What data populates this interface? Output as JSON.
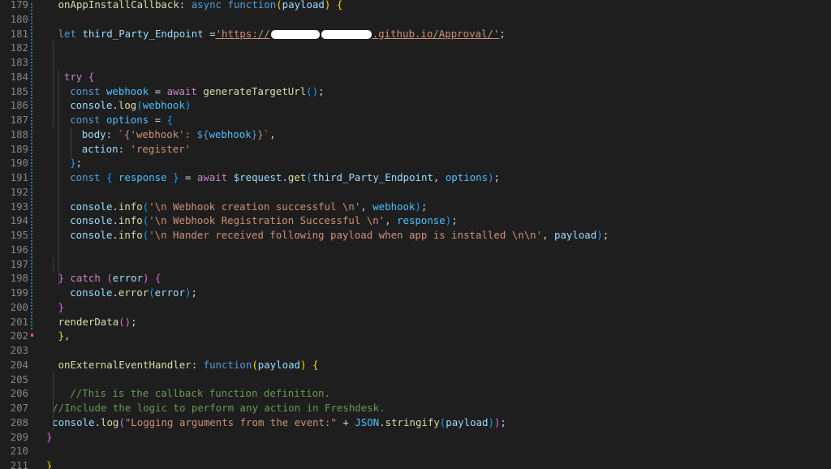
{
  "colors": {
    "background": "#1e1e1e",
    "line_number": "#858585",
    "default_text": "#d4d4d4",
    "change_marker": "#1b81a8",
    "deleted_marker": "#e85858"
  },
  "editor": {
    "lines": [
      {
        "n": "179",
        "indent": 2,
        "tokens": [
          {
            "t": "onAppInstallCallback",
            "c": "#dcdcaa",
            "name": "function-name"
          },
          {
            "t": ": ",
            "c": "#d4d4d4"
          },
          {
            "t": "async",
            "c": "#569cd6",
            "name": "keyword"
          },
          {
            "t": " ",
            "c": "#d4d4d4"
          },
          {
            "t": "function",
            "c": "#569cd6",
            "name": "keyword"
          },
          {
            "t": "(",
            "c": "#ffd700"
          },
          {
            "t": "payload",
            "c": "#9cdcfe",
            "name": "identifier"
          },
          {
            "t": ")",
            "c": "#ffd700"
          },
          {
            "t": " ",
            "c": "#d4d4d4"
          },
          {
            "t": "{",
            "c": "#ffd700"
          }
        ]
      },
      {
        "n": "180",
        "indent": 0,
        "tokens": []
      },
      {
        "n": "181",
        "indent": 2,
        "tokens": [
          {
            "t": "let",
            "c": "#569cd6",
            "name": "keyword"
          },
          {
            "t": " ",
            "c": "#d4d4d4"
          },
          {
            "t": "third_Party_Endpoint",
            "c": "#9cdcfe",
            "name": "identifier"
          },
          {
            "t": " =",
            "c": "#d4d4d4"
          },
          {
            "t": "'https://",
            "c": "#ce9178",
            "name": "string",
            "underline": true
          },
          {
            "redact": 60
          },
          {
            "t": "",
            "c": "#ce9178",
            "name": "string"
          },
          {
            "redact": 62
          },
          {
            "t": ".github.io/Approval/'",
            "c": "#ce9178",
            "name": "string",
            "underline": true
          },
          {
            "t": ";",
            "c": "#d4d4d4"
          }
        ]
      },
      {
        "n": "182",
        "indent": 0,
        "tokens": []
      },
      {
        "n": "183",
        "indent": 0,
        "tokens": []
      },
      {
        "n": "184",
        "indent": 3,
        "tokens": [
          {
            "t": "try",
            "c": "#c586c0",
            "name": "keyword"
          },
          {
            "t": " ",
            "c": "#d4d4d4"
          },
          {
            "t": "{",
            "c": "#da70d6"
          }
        ]
      },
      {
        "n": "185",
        "indent": 4,
        "tokens": [
          {
            "t": "const",
            "c": "#569cd6",
            "name": "keyword"
          },
          {
            "t": " ",
            "c": "#d4d4d4"
          },
          {
            "t": "webhook",
            "c": "#4fc1ff",
            "name": "identifier"
          },
          {
            "t": " = ",
            "c": "#d4d4d4"
          },
          {
            "t": "await",
            "c": "#c586c0",
            "name": "keyword"
          },
          {
            "t": " ",
            "c": "#d4d4d4"
          },
          {
            "t": "generateTargetUrl",
            "c": "#dcdcaa",
            "name": "function-name"
          },
          {
            "t": "()",
            "c": "#179fff"
          },
          {
            "t": ";",
            "c": "#d4d4d4"
          }
        ]
      },
      {
        "n": "186",
        "indent": 4,
        "tokens": [
          {
            "t": "console",
            "c": "#9cdcfe",
            "name": "identifier"
          },
          {
            "t": ".",
            "c": "#d4d4d4"
          },
          {
            "t": "log",
            "c": "#dcdcaa",
            "name": "function-name"
          },
          {
            "t": "(",
            "c": "#179fff"
          },
          {
            "t": "webhook",
            "c": "#4fc1ff",
            "name": "identifier"
          },
          {
            "t": ")",
            "c": "#179fff"
          }
        ]
      },
      {
        "n": "187",
        "indent": 4,
        "tokens": [
          {
            "t": "const",
            "c": "#569cd6",
            "name": "keyword"
          },
          {
            "t": " ",
            "c": "#d4d4d4"
          },
          {
            "t": "options",
            "c": "#4fc1ff",
            "name": "identifier"
          },
          {
            "t": " = ",
            "c": "#d4d4d4"
          },
          {
            "t": "{",
            "c": "#179fff"
          }
        ]
      },
      {
        "n": "188",
        "indent": 6,
        "tokens": [
          {
            "t": "body",
            "c": "#9cdcfe",
            "name": "identifier"
          },
          {
            "t": ": ",
            "c": "#d4d4d4"
          },
          {
            "t": "`{'webhook': ",
            "c": "#ce9178",
            "name": "string"
          },
          {
            "t": "${",
            "c": "#569cd6"
          },
          {
            "t": "webhook",
            "c": "#4fc1ff",
            "name": "identifier"
          },
          {
            "t": "}",
            "c": "#569cd6"
          },
          {
            "t": "}`",
            "c": "#ce9178",
            "name": "string"
          },
          {
            "t": ",",
            "c": "#d4d4d4"
          }
        ]
      },
      {
        "n": "189",
        "indent": 6,
        "tokens": [
          {
            "t": "action",
            "c": "#9cdcfe",
            "name": "identifier"
          },
          {
            "t": ": ",
            "c": "#d4d4d4"
          },
          {
            "t": "'register'",
            "c": "#ce9178",
            "name": "string"
          }
        ]
      },
      {
        "n": "190",
        "indent": 4,
        "tokens": [
          {
            "t": "}",
            "c": "#179fff"
          },
          {
            "t": ";",
            "c": "#d4d4d4"
          }
        ]
      },
      {
        "n": "191",
        "indent": 4,
        "tokens": [
          {
            "t": "const",
            "c": "#569cd6",
            "name": "keyword"
          },
          {
            "t": " ",
            "c": "#d4d4d4"
          },
          {
            "t": "{",
            "c": "#179fff"
          },
          {
            "t": " ",
            "c": "#d4d4d4"
          },
          {
            "t": "response",
            "c": "#4fc1ff",
            "name": "identifier"
          },
          {
            "t": " ",
            "c": "#d4d4d4"
          },
          {
            "t": "}",
            "c": "#179fff"
          },
          {
            "t": " = ",
            "c": "#d4d4d4"
          },
          {
            "t": "await",
            "c": "#c586c0",
            "name": "keyword"
          },
          {
            "t": " ",
            "c": "#d4d4d4"
          },
          {
            "t": "$request",
            "c": "#9cdcfe",
            "name": "identifier"
          },
          {
            "t": ".",
            "c": "#d4d4d4"
          },
          {
            "t": "get",
            "c": "#dcdcaa",
            "name": "function-name"
          },
          {
            "t": "(",
            "c": "#179fff"
          },
          {
            "t": "third_Party_Endpoint",
            "c": "#9cdcfe",
            "name": "identifier"
          },
          {
            "t": ", ",
            "c": "#d4d4d4"
          },
          {
            "t": "options",
            "c": "#4fc1ff",
            "name": "identifier"
          },
          {
            "t": ")",
            "c": "#179fff"
          },
          {
            "t": ";",
            "c": "#d4d4d4"
          }
        ]
      },
      {
        "n": "192",
        "indent": 0,
        "tokens": []
      },
      {
        "n": "193",
        "indent": 4,
        "tokens": [
          {
            "t": "console",
            "c": "#9cdcfe",
            "name": "identifier"
          },
          {
            "t": ".",
            "c": "#d4d4d4"
          },
          {
            "t": "info",
            "c": "#dcdcaa",
            "name": "function-name"
          },
          {
            "t": "(",
            "c": "#179fff"
          },
          {
            "t": "'\\n Webhook creation successful \\n'",
            "c": "#ce9178",
            "name": "string"
          },
          {
            "t": ", ",
            "c": "#d4d4d4"
          },
          {
            "t": "webhook",
            "c": "#4fc1ff",
            "name": "identifier"
          },
          {
            "t": ")",
            "c": "#179fff"
          },
          {
            "t": ";",
            "c": "#d4d4d4"
          }
        ]
      },
      {
        "n": "194",
        "indent": 4,
        "tokens": [
          {
            "t": "console",
            "c": "#9cdcfe",
            "name": "identifier"
          },
          {
            "t": ".",
            "c": "#d4d4d4"
          },
          {
            "t": "info",
            "c": "#dcdcaa",
            "name": "function-name"
          },
          {
            "t": "(",
            "c": "#179fff"
          },
          {
            "t": "'\\n Webhook Registration Successful \\n'",
            "c": "#ce9178",
            "name": "string"
          },
          {
            "t": ", ",
            "c": "#d4d4d4"
          },
          {
            "t": "response",
            "c": "#4fc1ff",
            "name": "identifier"
          },
          {
            "t": ")",
            "c": "#179fff"
          },
          {
            "t": ";",
            "c": "#d4d4d4"
          }
        ]
      },
      {
        "n": "195",
        "indent": 4,
        "tokens": [
          {
            "t": "console",
            "c": "#9cdcfe",
            "name": "identifier"
          },
          {
            "t": ".",
            "c": "#d4d4d4"
          },
          {
            "t": "info",
            "c": "#dcdcaa",
            "name": "function-name"
          },
          {
            "t": "(",
            "c": "#179fff"
          },
          {
            "t": "'\\n Hander received following payload when app is installed \\n\\n'",
            "c": "#ce9178",
            "name": "string"
          },
          {
            "t": ", ",
            "c": "#d4d4d4"
          },
          {
            "t": "payload",
            "c": "#9cdcfe",
            "name": "identifier"
          },
          {
            "t": ")",
            "c": "#179fff"
          },
          {
            "t": ";",
            "c": "#d4d4d4"
          }
        ]
      },
      {
        "n": "196",
        "indent": 0,
        "tokens": []
      },
      {
        "n": "197",
        "indent": 0,
        "tokens": []
      },
      {
        "n": "198",
        "indent": 2,
        "tokens": [
          {
            "t": "}",
            "c": "#da70d6"
          },
          {
            "t": " ",
            "c": "#d4d4d4"
          },
          {
            "t": "catch",
            "c": "#c586c0",
            "name": "keyword"
          },
          {
            "t": " ",
            "c": "#d4d4d4"
          },
          {
            "t": "(",
            "c": "#da70d6"
          },
          {
            "t": "error",
            "c": "#9cdcfe",
            "name": "identifier"
          },
          {
            "t": ")",
            "c": "#da70d6"
          },
          {
            "t": " ",
            "c": "#d4d4d4"
          },
          {
            "t": "{",
            "c": "#da70d6"
          }
        ]
      },
      {
        "n": "199",
        "indent": 4,
        "tokens": [
          {
            "t": "console",
            "c": "#9cdcfe",
            "name": "identifier"
          },
          {
            "t": ".",
            "c": "#d4d4d4"
          },
          {
            "t": "error",
            "c": "#dcdcaa",
            "name": "function-name"
          },
          {
            "t": "(",
            "c": "#179fff"
          },
          {
            "t": "error",
            "c": "#9cdcfe",
            "name": "identifier"
          },
          {
            "t": ")",
            "c": "#179fff"
          },
          {
            "t": ";",
            "c": "#d4d4d4"
          }
        ]
      },
      {
        "n": "200",
        "indent": 2,
        "tokens": [
          {
            "t": "}",
            "c": "#da70d6"
          }
        ]
      },
      {
        "n": "201",
        "indent": 2,
        "tokens": [
          {
            "t": "renderData",
            "c": "#dcdcaa",
            "name": "function-name"
          },
          {
            "t": "()",
            "c": "#da70d6"
          },
          {
            "t": ";",
            "c": "#d4d4d4"
          }
        ]
      },
      {
        "n": "202",
        "indent": 2,
        "tokens": [
          {
            "t": "}",
            "c": "#ffd700"
          },
          {
            "t": ",",
            "c": "#d4d4d4"
          }
        ]
      },
      {
        "n": "203",
        "indent": 0,
        "tokens": []
      },
      {
        "n": "204",
        "indent": 2,
        "tokens": [
          {
            "t": "onExternalEventHandler",
            "c": "#dcdcaa",
            "name": "function-name"
          },
          {
            "t": ": ",
            "c": "#d4d4d4"
          },
          {
            "t": "function",
            "c": "#569cd6",
            "name": "keyword"
          },
          {
            "t": "(",
            "c": "#ffd700"
          },
          {
            "t": "payload",
            "c": "#9cdcfe",
            "name": "identifier"
          },
          {
            "t": ")",
            "c": "#ffd700"
          },
          {
            "t": " ",
            "c": "#d4d4d4"
          },
          {
            "t": "{",
            "c": "#ffd700"
          }
        ]
      },
      {
        "n": "205",
        "indent": 0,
        "tokens": []
      },
      {
        "n": "206",
        "indent": 4,
        "tokens": [
          {
            "t": "//This is the callback function definition.",
            "c": "#6a9955",
            "name": "comment"
          }
        ]
      },
      {
        "n": "207",
        "indent": 1,
        "tokens": [
          {
            "t": "//Include the logic to perform any action in Freshdesk.",
            "c": "#6a9955",
            "name": "comment"
          }
        ]
      },
      {
        "n": "208",
        "indent": 1,
        "tokens": [
          {
            "t": "console",
            "c": "#9cdcfe",
            "name": "identifier"
          },
          {
            "t": ".",
            "c": "#d4d4d4"
          },
          {
            "t": "log",
            "c": "#dcdcaa",
            "name": "function-name"
          },
          {
            "t": "(",
            "c": "#da70d6"
          },
          {
            "t": "\"Logging arguments from the event:\"",
            "c": "#ce9178",
            "name": "string"
          },
          {
            "t": " + ",
            "c": "#d4d4d4"
          },
          {
            "t": "JSON",
            "c": "#4fc1ff",
            "name": "identifier"
          },
          {
            "t": ".",
            "c": "#d4d4d4"
          },
          {
            "t": "stringify",
            "c": "#dcdcaa",
            "name": "function-name"
          },
          {
            "t": "(",
            "c": "#179fff"
          },
          {
            "t": "payload",
            "c": "#9cdcfe",
            "name": "identifier"
          },
          {
            "t": ")",
            "c": "#179fff"
          },
          {
            "t": ")",
            "c": "#da70d6"
          },
          {
            "t": ";",
            "c": "#d4d4d4"
          }
        ]
      },
      {
        "n": "209",
        "indent": 0,
        "tokens": [
          {
            "t": "}",
            "c": "#da70d6"
          }
        ]
      },
      {
        "n": "210",
        "indent": 0,
        "tokens": []
      },
      {
        "n": "211",
        "indent": 0,
        "tokens": [
          {
            "t": "}",
            "c": "#ffd700"
          }
        ]
      }
    ]
  }
}
